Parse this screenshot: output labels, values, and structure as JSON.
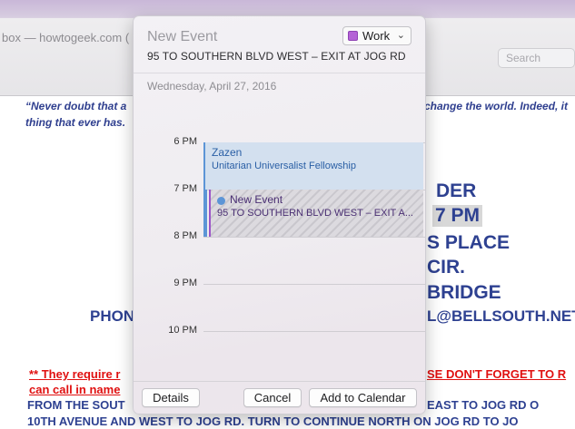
{
  "background_window": {
    "title": "box — howtogeek.com (",
    "search_placeholder": "Search",
    "quote_line1": "“Never doubt that a",
    "quote_line1_right": "change the world. Indeed, it",
    "quote_line2": "thing that ever has.",
    "line_der": "DER",
    "line_7pm": "7 PM",
    "line_s_place": "S PLACE",
    "line_cir": "CIR.",
    "line_bridge": "BRIDGE",
    "line_phon": "PHON",
    "line_bellsouth": "L@BELLSOUTH.NET",
    "line_require": "**  They require r",
    "line_require_right": "SE DON'T FORGET TO R",
    "line_can_call": "can call in name",
    "line_from_south": "FROM THE SOUT",
    "line_from_south_right": "EAST TO JOG RD  O",
    "line_10th": "10TH AVENUE AND WEST TO JOG RD.  TURN TO CONTINUE NORTH ON JOG RD TO JO"
  },
  "popover": {
    "title": "New Event",
    "location": "95 TO SOUTHERN BLVD WEST – EXIT AT JOG RD",
    "calendar": {
      "label": "Work",
      "color": "#b463d6"
    },
    "date": "Wednesday, April 27, 2016",
    "hours": [
      "6 PM",
      "7 PM",
      "8 PM",
      "9 PM",
      "10 PM"
    ],
    "events": {
      "zazen": {
        "title": "Zazen",
        "subtitle": "Unitarian Universalist Fellowship",
        "color": "#5c95d6"
      },
      "new_event": {
        "title": "New Event",
        "subtitle": "95 TO SOUTHERN BLVD WEST – EXIT A...",
        "color": "#9b55c8"
      }
    },
    "buttons": {
      "details": "Details",
      "cancel": "Cancel",
      "add": "Add to Calendar"
    }
  }
}
